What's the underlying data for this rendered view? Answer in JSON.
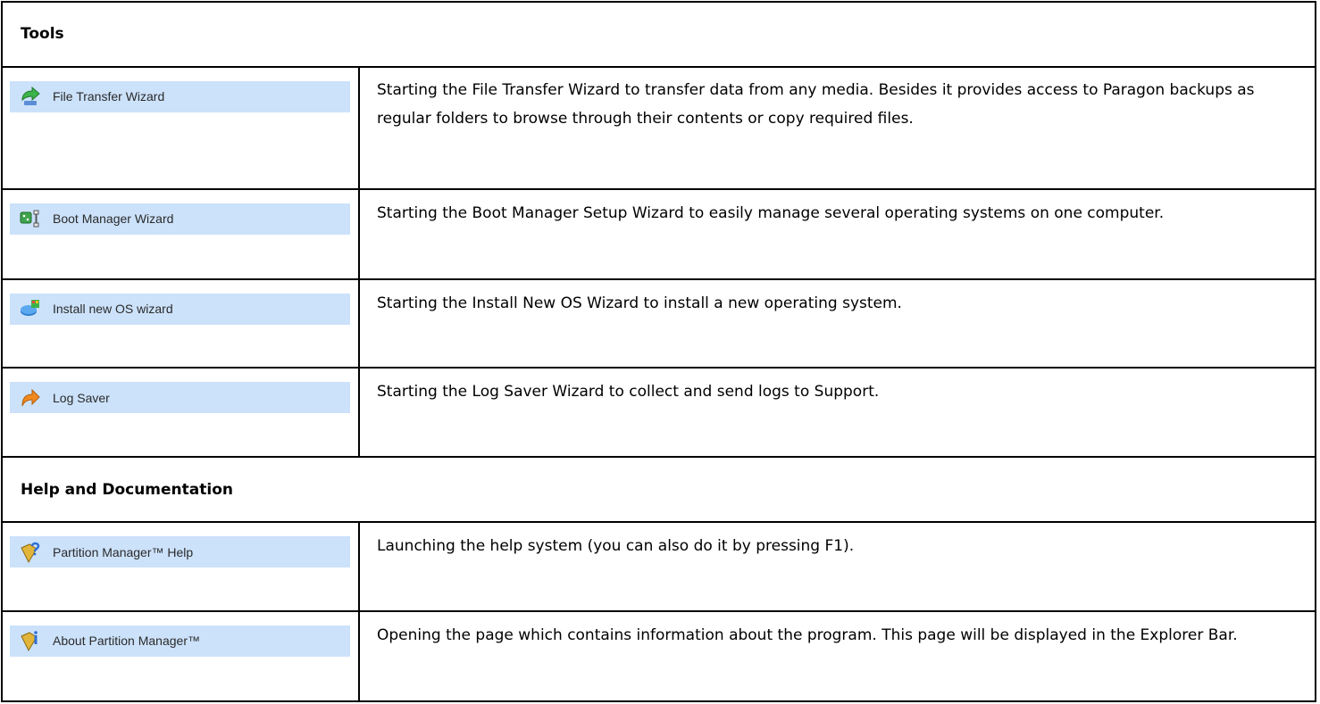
{
  "sections": [
    {
      "heading": "Tools",
      "items": [
        {
          "label": "File Transfer Wizard",
          "icon": "green-arrow-icon",
          "description": "Starting the File Transfer Wizard to transfer data from any media. Besides it provides access to Paragon backups as regular folders to browse through their contents or copy required files."
        },
        {
          "label": "Boot Manager Wizard",
          "icon": "boot-manager-icon",
          "description": "Starting the Boot Manager Setup Wizard to easily manage several operating systems on one computer."
        },
        {
          "label": "Install new OS wizard",
          "icon": "install-os-icon",
          "description": "Starting the Install New OS Wizard to install a new operating system."
        },
        {
          "label": "Log Saver",
          "icon": "orange-arrow-icon",
          "description": "Starting the Log Saver Wizard to collect and send logs to Support."
        }
      ]
    },
    {
      "heading": "Help and Documentation",
      "items": [
        {
          "label": "Partition Manager™ Help",
          "icon": "help-book-icon",
          "description": "Launching the help system (you can also do it by pressing F1)."
        },
        {
          "label": "About Partition Manager™",
          "icon": "about-book-icon",
          "description": "Opening the page which contains information about the program. This page will be displayed in the Explorer Bar."
        }
      ]
    }
  ]
}
